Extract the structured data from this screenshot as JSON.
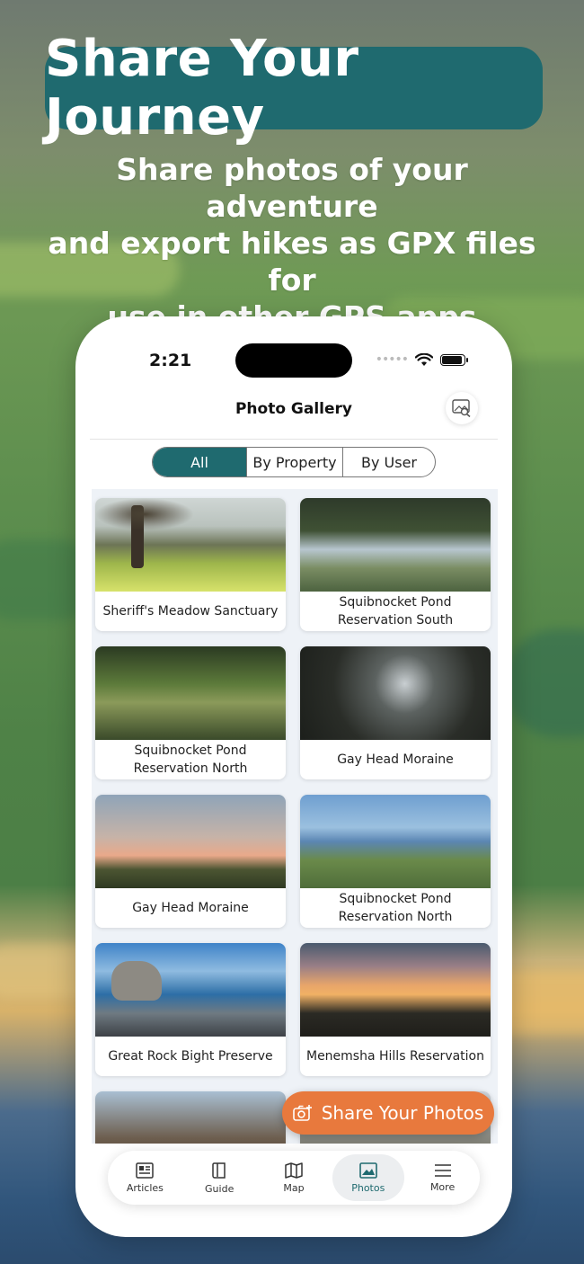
{
  "banner": {
    "title": "Share Your Journey"
  },
  "subtitle": {
    "line1": "Share photos of your adventure",
    "line2": "and export hikes as GPX files for",
    "line3": "use in other GPS apps"
  },
  "status": {
    "time": "2:21"
  },
  "nav": {
    "title": "Photo Gallery"
  },
  "segments": [
    {
      "label": "All"
    },
    {
      "label": "By Property"
    },
    {
      "label": "By User"
    }
  ],
  "active_segment": "All",
  "cards": [
    {
      "caption": "Sheriff's Meadow Sanctuary"
    },
    {
      "caption": "Squibnocket Pond Reservation South"
    },
    {
      "caption": "Squibnocket Pond Reservation North"
    },
    {
      "caption": "Gay Head Moraine"
    },
    {
      "caption": "Gay Head Moraine"
    },
    {
      "caption": "Squibnocket Pond Reservation North"
    },
    {
      "caption": "Great Rock Bight Preserve"
    },
    {
      "caption": "Menemsha Hills Reservation"
    }
  ],
  "fab": {
    "label": "Share Your Photos"
  },
  "tabs": [
    {
      "label": "Articles",
      "icon": "articles-icon"
    },
    {
      "label": "Guide",
      "icon": "guide-icon"
    },
    {
      "label": "Map",
      "icon": "map-icon"
    },
    {
      "label": "Photos",
      "icon": "photos-icon"
    },
    {
      "label": "More",
      "icon": "menu-icon"
    }
  ],
  "active_tab": "Photos",
  "colors": {
    "teal": "#1f6a6f",
    "orange": "#e8793d"
  }
}
